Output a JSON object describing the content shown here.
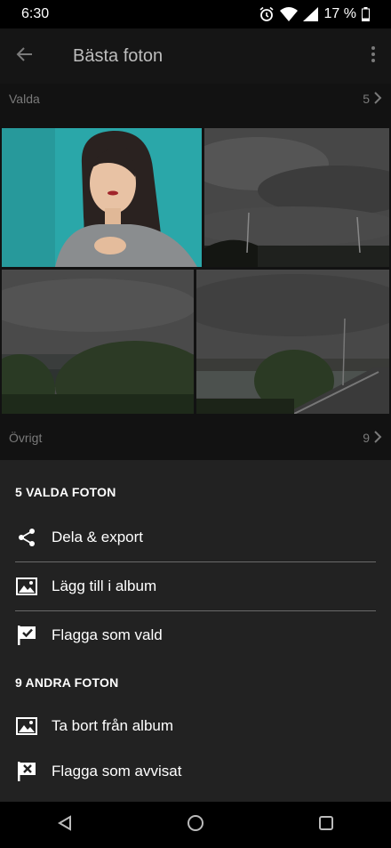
{
  "status_bar": {
    "time": "6:30",
    "battery": "17 %"
  },
  "app_bar": {
    "title": "Bästa foton"
  },
  "sections": {
    "picked": {
      "label": "Valda",
      "count": "5"
    },
    "other": {
      "label": "Övrigt",
      "count": "9"
    }
  },
  "sheet": {
    "picked_heading": "5 VALDA FOTON",
    "picked_actions": [
      {
        "label": "Dela & export",
        "icon": "share-icon"
      },
      {
        "label": "Lägg till i album",
        "icon": "album-add-icon"
      },
      {
        "label": "Flagga som vald",
        "icon": "flag-picked-icon"
      }
    ],
    "other_heading": "9 ANDRA FOTON",
    "other_actions": [
      {
        "label": "Ta bort från album",
        "icon": "album-remove-icon"
      },
      {
        "label": "Flagga som avvisat",
        "icon": "flag-rejected-icon"
      }
    ]
  },
  "colors": {
    "accent_portrait_bg": "#2aa7a9",
    "sheet_bg": "#222222"
  }
}
